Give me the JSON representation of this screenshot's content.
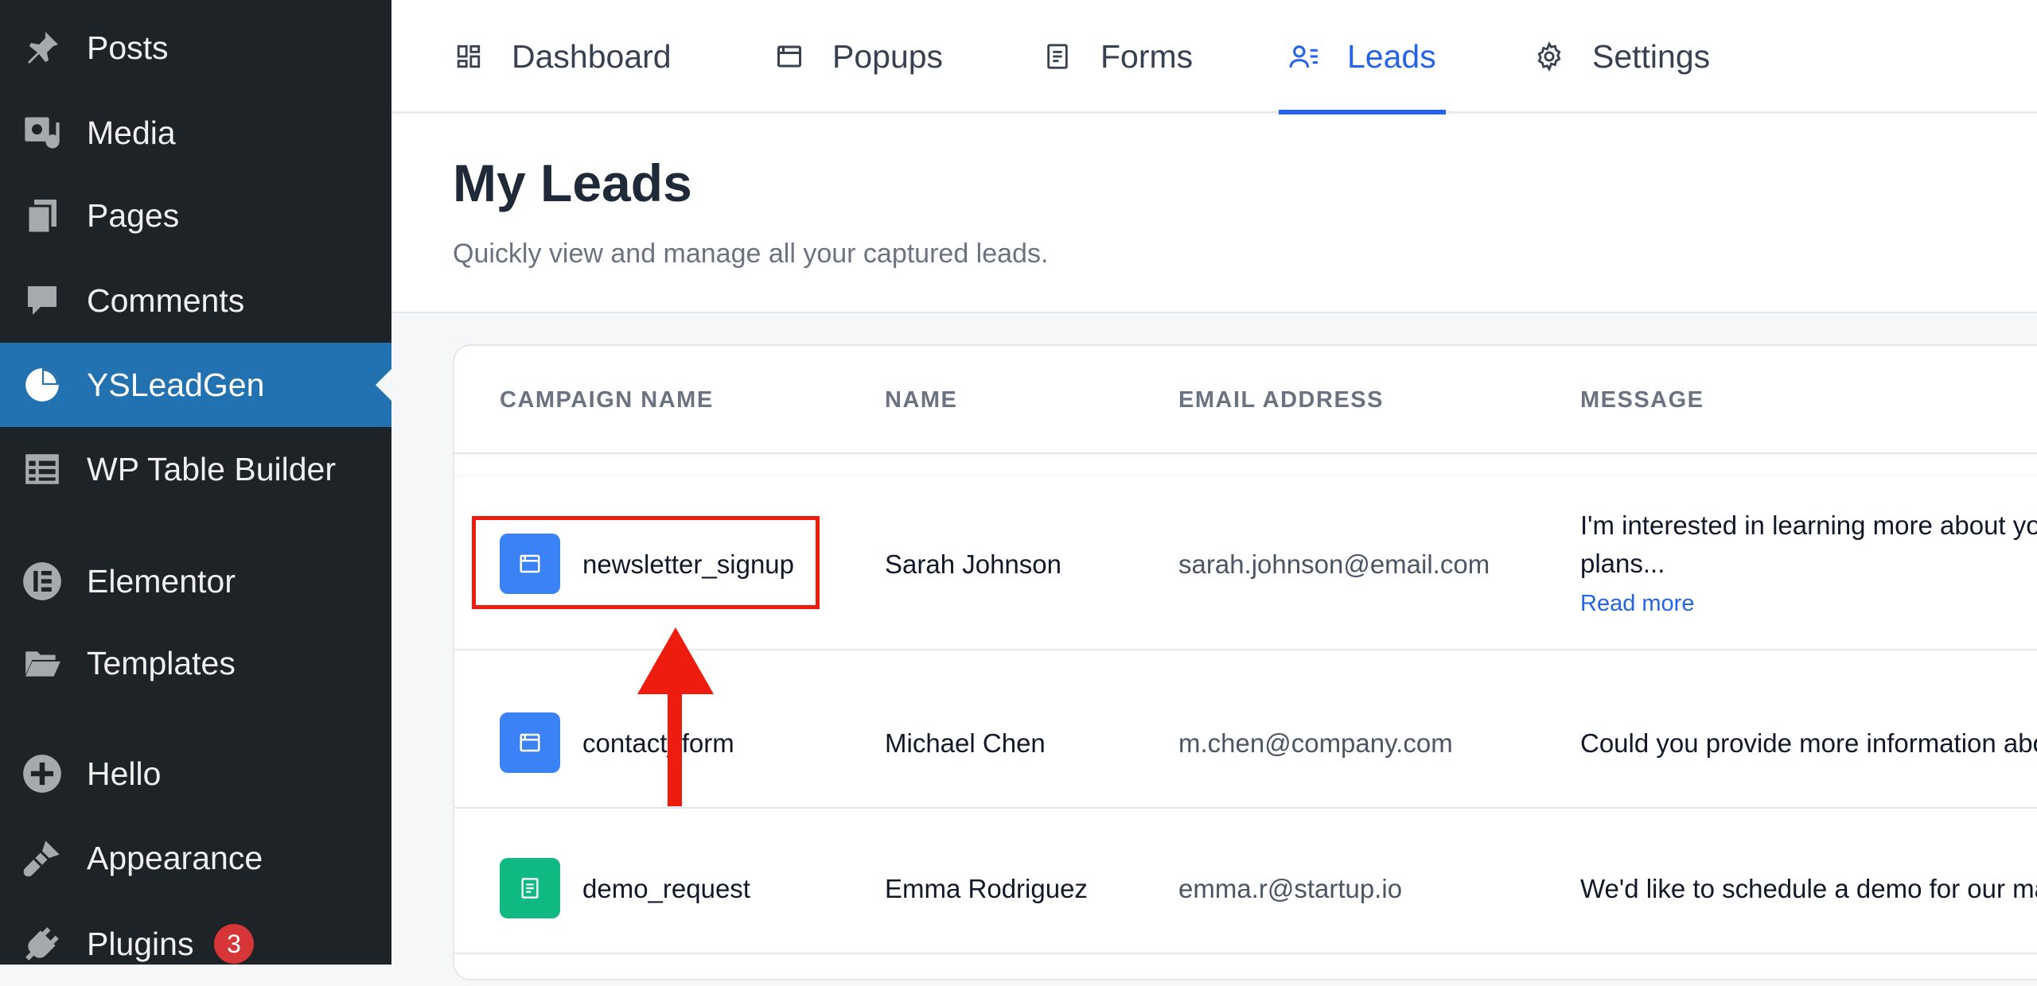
{
  "sidebar": {
    "items": [
      {
        "label": "Posts",
        "icon": "pushpin-icon"
      },
      {
        "label": "Media",
        "icon": "media-icon"
      },
      {
        "label": "Pages",
        "icon": "pages-icon"
      },
      {
        "label": "Comments",
        "icon": "comment-icon"
      },
      {
        "label": "YSLeadGen",
        "icon": "pie-chart-icon",
        "active": true
      },
      {
        "label": "WP Table Builder",
        "icon": "table-icon"
      },
      {
        "label": "Elementor",
        "icon": "elementor-icon"
      },
      {
        "label": "Templates",
        "icon": "folder-icon"
      },
      {
        "label": "Hello",
        "icon": "plus-circle-icon"
      },
      {
        "label": "Appearance",
        "icon": "paintbrush-icon"
      },
      {
        "label": "Plugins",
        "icon": "plug-icon",
        "badge": "3"
      }
    ]
  },
  "tabs": [
    {
      "label": "Dashboard",
      "icon": "dashboard-grid-icon"
    },
    {
      "label": "Popups",
      "icon": "popup-window-icon"
    },
    {
      "label": "Forms",
      "icon": "form-document-icon"
    },
    {
      "label": "Leads",
      "icon": "leads-user-icon",
      "active": true
    },
    {
      "label": "Settings",
      "icon": "gear-icon"
    }
  ],
  "header": {
    "title": "My Leads",
    "subtitle": "Quickly view and manage all your captured leads."
  },
  "table": {
    "columns": [
      "CAMPAIGN NAME",
      "NAME",
      "EMAIL ADDRESS",
      "MESSAGE"
    ],
    "rows": [
      {
        "campaign": "newsletter_signup",
        "campaign_type": "popup",
        "name": "Sarah Johnson",
        "email": "sarah.johnson@email.com",
        "message_line1": "I'm interested in learning more about yo",
        "message_line2": "plans...",
        "read_more": "Read more"
      },
      {
        "campaign": "contact_form",
        "campaign_type": "popup",
        "name": "Michael Chen",
        "email": "m.chen@company.com",
        "message_line1": "Could you provide more information abo"
      },
      {
        "campaign": "demo_request",
        "campaign_type": "form",
        "name": "Emma Rodriguez",
        "email": "emma.r@startup.io",
        "message_line1": "We'd like to schedule a demo for our ma"
      }
    ]
  },
  "colors": {
    "sidebar_bg": "#1e2327",
    "sidebar_active": "#2271b1",
    "accent": "#2563eb",
    "popup_icon_bg": "#3b82f6",
    "form_icon_bg": "#10b981",
    "annotation": "#ee1c0e",
    "badge": "#d63638"
  }
}
